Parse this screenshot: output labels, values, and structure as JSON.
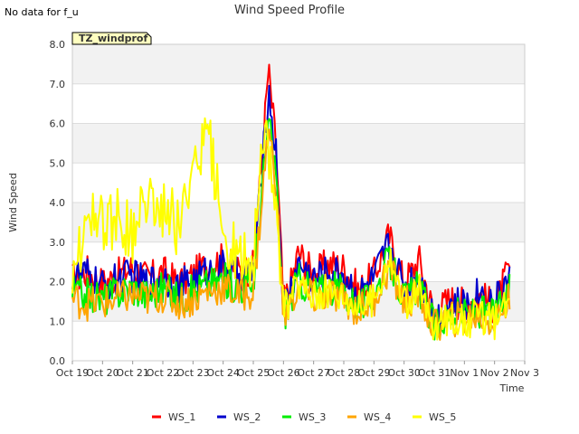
{
  "no_data_note": "No data for f_u",
  "chart_data": {
    "type": "line",
    "title": "Wind Speed Profile",
    "badge": "TZ_windprof",
    "xlabel": "Time",
    "ylabel": "Wind Speed",
    "ylim": [
      0,
      8
    ],
    "yticks": [
      "0.0",
      "1.0",
      "2.0",
      "3.0",
      "4.0",
      "5.0",
      "6.0",
      "7.0",
      "8.0"
    ],
    "xlim": [
      "Oct 19",
      "Nov 3"
    ],
    "xticks": [
      "Oct 19",
      "Oct 20",
      "Oct 21",
      "Oct 22",
      "Oct 23",
      "Oct 24",
      "Oct 25",
      "Oct 26",
      "Oct 27",
      "Oct 28",
      "Oct 29",
      "Oct 30",
      "Oct 31",
      "Nov 1",
      "Nov 2",
      "Nov 3"
    ],
    "x_day_offsets": [
      0,
      0.5,
      1,
      1.5,
      2,
      2.5,
      3,
      3.5,
      4,
      4.5,
      5,
      5.5,
      6,
      6.25,
      6.5,
      6.75,
      7,
      7.25,
      7.5,
      8,
      8.5,
      9,
      9.5,
      10,
      10.5,
      11,
      11.5,
      12,
      12.5,
      13,
      13.5,
      14,
      14.5
    ],
    "grid": true,
    "legend_position": "bottom",
    "series": [
      {
        "name": "WS_1",
        "color": "#ff0000",
        "values": [
          2.1,
          2.3,
          2.0,
          2.2,
          2.4,
          2.1,
          2.3,
          2.0,
          2.2,
          2.5,
          2.6,
          2.3,
          2.4,
          4.8,
          7.4,
          5.5,
          1.5,
          2.0,
          2.8,
          2.2,
          2.5,
          2.4,
          1.8,
          2.2,
          3.2,
          2.0,
          2.6,
          1.2,
          1.6,
          1.5,
          1.7,
          1.4,
          2.4
        ]
      },
      {
        "name": "WS_2",
        "color": "#0000cc",
        "values": [
          2.2,
          2.2,
          1.9,
          2.1,
          2.2,
          2.0,
          2.2,
          1.9,
          2.1,
          2.3,
          2.4,
          2.2,
          2.3,
          4.5,
          6.9,
          5.3,
          1.4,
          1.9,
          2.5,
          2.1,
          2.3,
          2.2,
          1.7,
          2.1,
          3.0,
          1.9,
          2.3,
          1.1,
          1.5,
          1.4,
          1.8,
          1.5,
          2.2
        ]
      },
      {
        "name": "WS_3",
        "color": "#00ee00",
        "values": [
          1.8,
          1.7,
          1.6,
          1.8,
          1.9,
          1.7,
          1.9,
          1.6,
          1.8,
          2.0,
          2.1,
          1.9,
          2.0,
          4.0,
          6.1,
          4.8,
          1.2,
          1.6,
          2.1,
          1.8,
          1.9,
          1.8,
          1.4,
          1.7,
          2.6,
          1.6,
          1.9,
          0.9,
          1.2,
          1.2,
          1.3,
          1.2,
          1.8
        ]
      },
      {
        "name": "WS_4",
        "color": "#ffa500",
        "values": [
          1.6,
          1.5,
          1.5,
          1.6,
          1.7,
          1.6,
          1.7,
          1.5,
          1.6,
          1.8,
          1.9,
          1.7,
          1.8,
          3.8,
          5.9,
          4.6,
          1.1,
          1.5,
          1.9,
          1.6,
          1.7,
          1.6,
          1.3,
          1.6,
          2.4,
          1.5,
          1.7,
          0.9,
          1.1,
          1.1,
          1.2,
          1.0,
          1.6
        ]
      },
      {
        "name": "WS_5",
        "color": "#ffff00",
        "values": [
          1.7,
          4.1,
          3.4,
          3.7,
          3.3,
          4.3,
          4.0,
          3.5,
          5.1,
          5.9,
          3.2,
          2.8,
          2.5,
          4.9,
          5.6,
          4.2,
          1.3,
          1.7,
          2.0,
          1.7,
          1.8,
          1.7,
          1.4,
          1.6,
          2.7,
          1.5,
          1.8,
          0.8,
          1.2,
          1.0,
          1.2,
          1.0,
          1.5
        ]
      }
    ]
  }
}
